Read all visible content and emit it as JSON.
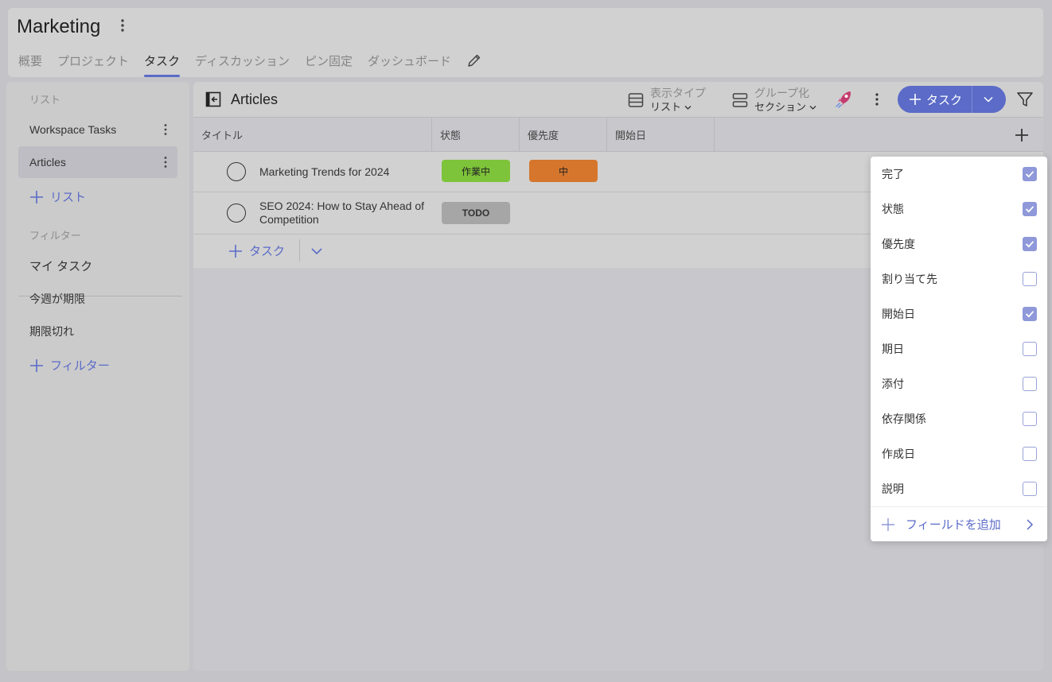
{
  "project": {
    "title": "Marketing",
    "tabs": [
      {
        "label": "概要",
        "active": false
      },
      {
        "label": "プロジェクト",
        "active": false
      },
      {
        "label": "タスク",
        "active": true
      },
      {
        "label": "ディスカッション",
        "active": false
      },
      {
        "label": "ピン固定",
        "active": false
      },
      {
        "label": "ダッシュボード",
        "active": false
      }
    ]
  },
  "sidebar": {
    "lists_heading": "リスト",
    "lists": [
      {
        "label": "Workspace Tasks",
        "active": false
      },
      {
        "label": "Articles",
        "active": true
      }
    ],
    "add_list_label": "リスト",
    "filters_heading": "フィルター",
    "filters": [
      {
        "label": "マイ タスク"
      },
      {
        "label": "今週が期限"
      },
      {
        "label": "期限切れ"
      }
    ],
    "add_filter_label": "フィルター"
  },
  "toolbar": {
    "list_title": "Articles",
    "view_type_label": "表示タイプ",
    "view_type_value": "リスト",
    "group_label": "グループ化",
    "group_value": "セクション",
    "add_task_label": "タスク"
  },
  "table": {
    "columns": [
      "タイトル",
      "状態",
      "優先度",
      "開始日"
    ],
    "rows": [
      {
        "title": "Marketing Trends for 2024",
        "status": "作業中",
        "status_color": "#7ec43a",
        "priority": "中",
        "priority_color": "#d5762c"
      },
      {
        "title": "SEO 2024: How to Stay Ahead of Competition",
        "status": "TODO",
        "status_color": "#a6a6a6",
        "priority": "",
        "priority_color": ""
      }
    ],
    "add_task_label": "タスク"
  },
  "field_menu": {
    "items": [
      {
        "label": "完了",
        "checked": true
      },
      {
        "label": "状態",
        "checked": true
      },
      {
        "label": "優先度",
        "checked": true
      },
      {
        "label": "割り当て先",
        "checked": false
      },
      {
        "label": "開始日",
        "checked": true
      },
      {
        "label": "期日",
        "checked": false
      },
      {
        "label": "添付",
        "checked": false
      },
      {
        "label": "依存関係",
        "checked": false
      },
      {
        "label": "作成日",
        "checked": false
      },
      {
        "label": "説明",
        "checked": false
      }
    ],
    "add_field_label": "フィールドを追加"
  },
  "colors": {
    "accent": "#5b6bc7",
    "checkbox_checked": "#8f99d9"
  }
}
